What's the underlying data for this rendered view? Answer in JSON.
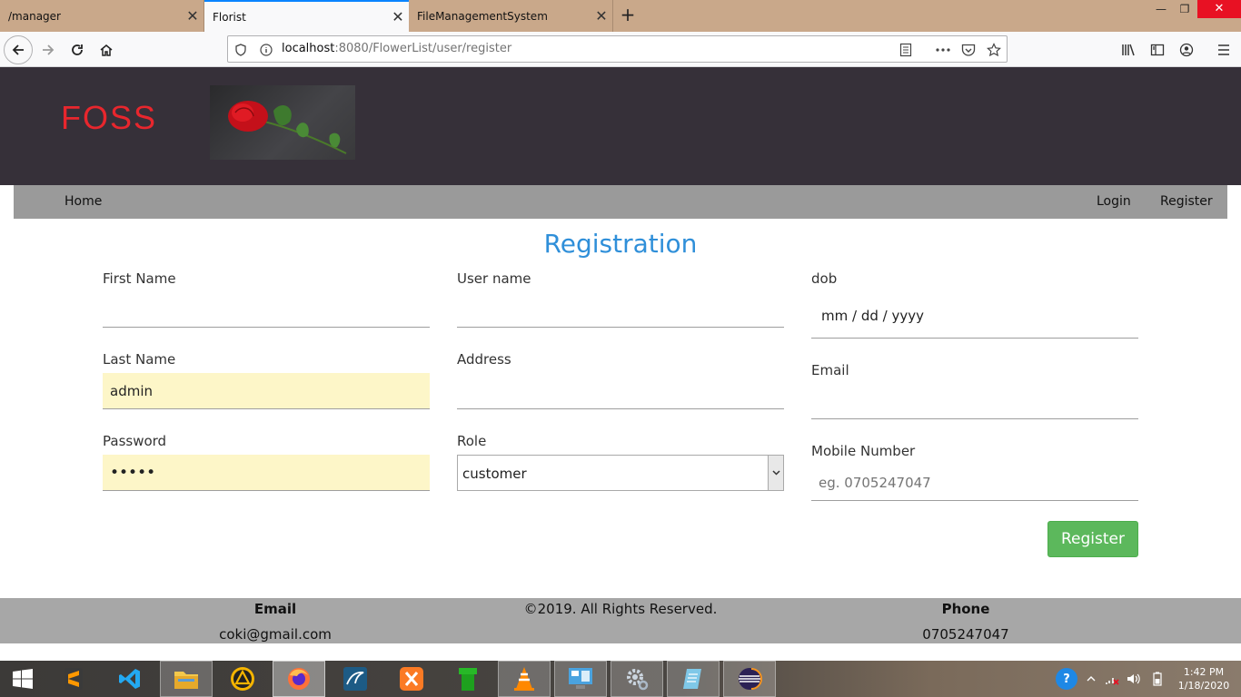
{
  "browser": {
    "tabs": [
      {
        "label": "/manager",
        "close": "✕"
      },
      {
        "label": "Florist",
        "close": "✕"
      },
      {
        "label": "FileManagementSystem",
        "close": "✕"
      }
    ],
    "new_tab": "+",
    "url_host": "localhost",
    "url_rest": ":8080/FlowerList/user/register",
    "window_controls": {
      "minimize": "—",
      "restore": "❐",
      "close": "✕"
    }
  },
  "site": {
    "logo": "FOSS",
    "menu": {
      "home": "Home",
      "login": "Login",
      "register": "Register"
    }
  },
  "form": {
    "title": "Registration",
    "first_name_label": "First Name",
    "first_name_value": "",
    "last_name_label": "Last Name",
    "last_name_value": "admin",
    "password_label": "Password",
    "password_value": "•••••",
    "username_label": "User name",
    "username_value": "",
    "address_label": "Address",
    "address_value": "",
    "role_label": "Role",
    "role_value": "customer",
    "dob_label": "dob",
    "dob_placeholder": "mm / dd / yyyy",
    "email_label": "Email",
    "email_value": "",
    "mobile_label": "Mobile Number",
    "mobile_placeholder": "eg. 0705247047",
    "submit_label": "Register"
  },
  "footer": {
    "email_heading": "Email",
    "email_value": "coki@gmail.com",
    "copyright": "©2019. All Rights Reserved.",
    "phone_heading": "Phone",
    "phone_value": "0705247047"
  },
  "taskbar": {
    "time": "1:42 PM",
    "date": "1/18/2020",
    "help": "?"
  },
  "colors": {
    "header_bg": "#363039",
    "logo": "#e8262d",
    "title": "#2f8fd9",
    "register_button": "#5cb85c",
    "autofill": "#fdf6c8"
  }
}
